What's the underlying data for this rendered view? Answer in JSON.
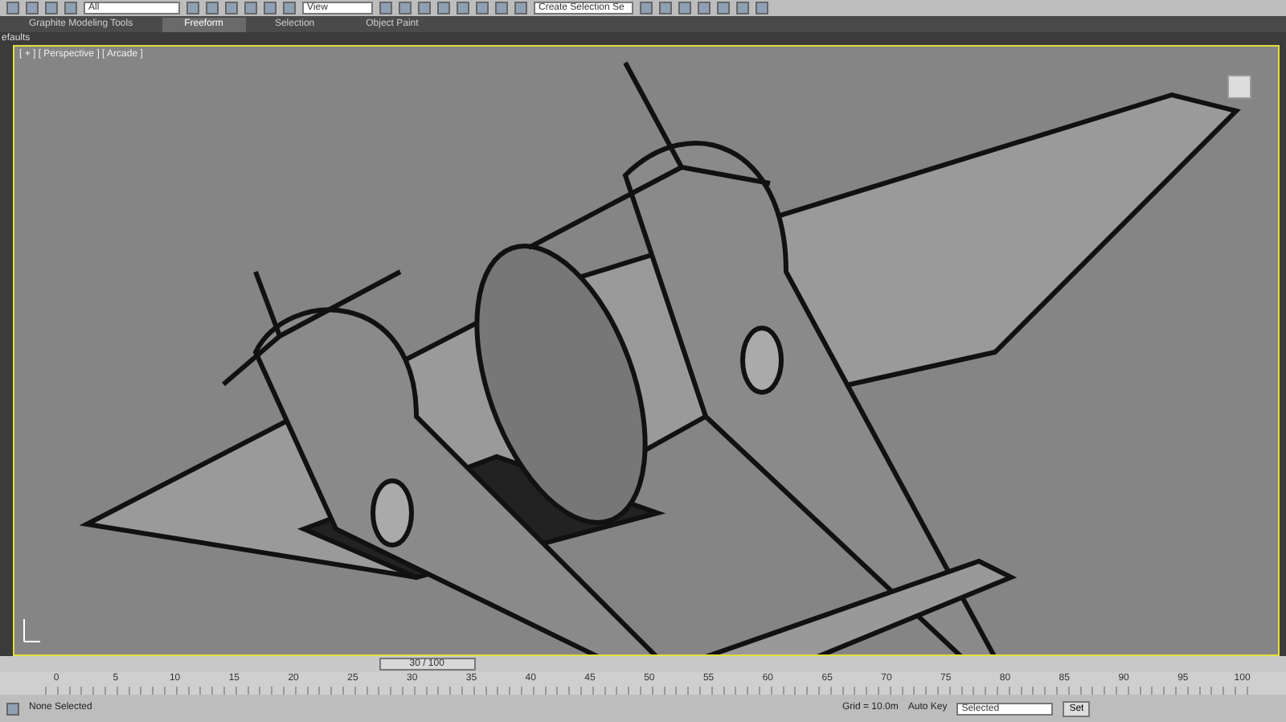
{
  "toolbar": {
    "selection_filter": "All",
    "reference_coord": "View",
    "named_selection": "Create Selection Se"
  },
  "ribbon_tabs": [
    {
      "label": "Graphite Modeling Tools",
      "selected": false
    },
    {
      "label": "Freeform",
      "selected": true
    },
    {
      "label": "Selection",
      "selected": false
    },
    {
      "label": "Object Paint",
      "selected": false
    }
  ],
  "ribbon_panel": {
    "label": "efaults"
  },
  "viewport": {
    "label": "[ + ] [ Perspective ] [ Arcade ]",
    "active": true
  },
  "time_slider": {
    "reading": "30 / 100",
    "level": 0.3
  },
  "timeline": {
    "ticks": [
      "0",
      "5",
      "10",
      "15",
      "20",
      "25",
      "30",
      "35",
      "40",
      "45",
      "50",
      "55",
      "60",
      "65",
      "70",
      "75",
      "80",
      "85",
      "90",
      "95",
      "100"
    ]
  },
  "status_bar": {
    "selection": "None Selected",
    "grid": "Grid = 10.0m",
    "auto_key": "Auto Key",
    "key_filter": "Selected",
    "set_key": "Set"
  }
}
